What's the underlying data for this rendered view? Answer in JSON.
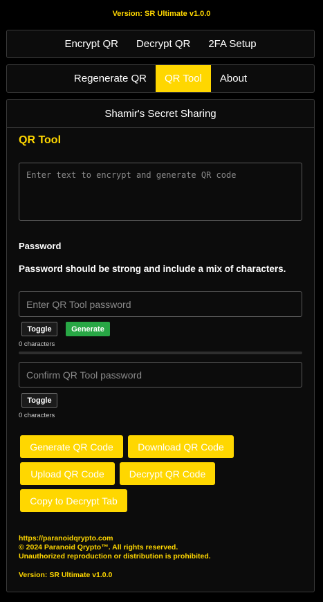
{
  "version_top": "Version: SR Ultimate v1.0.0",
  "nav_primary": [
    "Encrypt QR",
    "Decrypt QR",
    "2FA Setup"
  ],
  "nav_secondary": [
    "Regenerate QR",
    "QR Tool",
    "About"
  ],
  "panel": {
    "header": "Shamir's Secret Sharing",
    "title": "QR Tool",
    "text_placeholder": "Enter text to encrypt and generate QR code",
    "password_label": "Password",
    "password_hint": "Password should be strong and include a mix of characters.",
    "password_placeholder": "Enter QR Tool password",
    "confirm_placeholder": "Confirm QR Tool password",
    "toggle_label": "Toggle",
    "generate_label": "Generate",
    "char_count_1": "0 characters",
    "char_count_2": "0 characters",
    "strength": 0
  },
  "actions": {
    "generate_qr": "Generate QR Code",
    "download_qr": "Download QR Code",
    "upload_qr": "Upload QR Code",
    "decrypt_qr": "Decrypt QR Code",
    "copy_decrypt": "Copy to Decrypt Tab"
  },
  "footer": {
    "url": "https://paranoidqrypto.com",
    "copyright": "© 2024 Paranoid Qrypto™. All rights reserved.",
    "notice": "Unauthorized reproduction or distribution is prohibited.",
    "version": "Version: SR Ultimate v1.0.0"
  },
  "colors": {
    "accent": "#ffd700",
    "success": "#28a745",
    "background": "#000000",
    "panel": "#0c0c0c"
  }
}
